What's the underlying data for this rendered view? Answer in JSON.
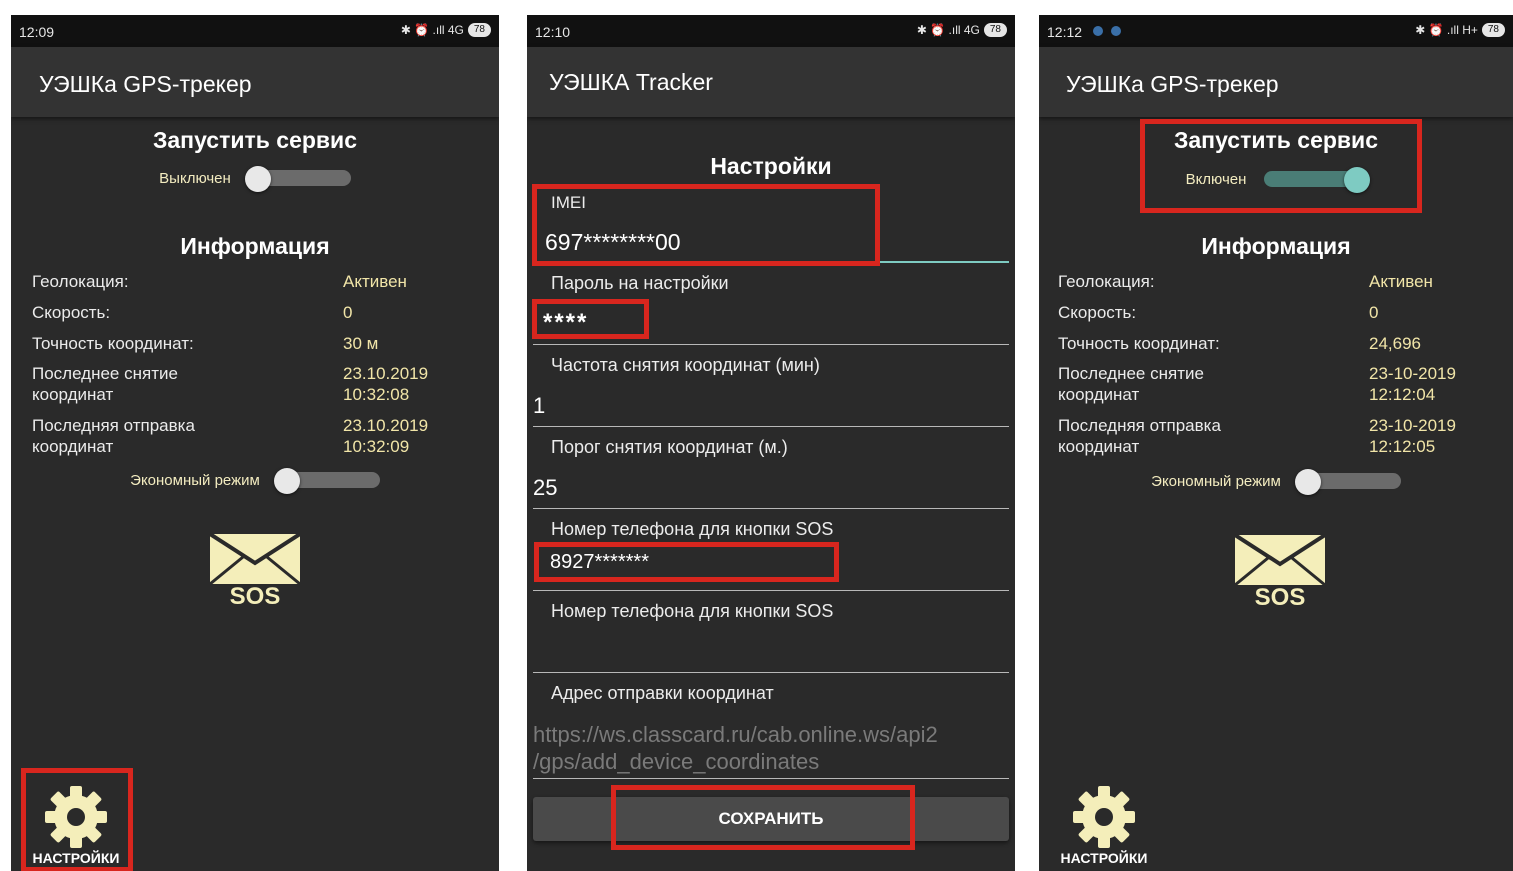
{
  "colors": {
    "accent_teal": "#7ecbc2",
    "value_yellow": "#f1e5a8",
    "highlight_red": "#d8261e",
    "background": "#2a2a2a"
  },
  "screen1": {
    "status_time": "12:09",
    "status_icons": "✱ ⏰ .ıll 4G",
    "battery": "78",
    "app_title": "УЭШКа GPS-трекер",
    "service_title": "Запустить сервис",
    "service_state_label": "Выключен",
    "service_on": false,
    "info_title": "Информация",
    "info": [
      {
        "label": "Геолокация:",
        "value": "Активен"
      },
      {
        "label": "Скорость:",
        "value": "0"
      },
      {
        "label": "Точность координат:",
        "value": "30 м"
      },
      {
        "label": "Последнее снятие координат",
        "value": "23.10.2019 10:32:08"
      },
      {
        "label": "Последняя отправка координат",
        "value": "23.10.2019 10:32:09"
      }
    ],
    "eco_label": "Экономный режим",
    "eco_on": false,
    "sos_label": "SOS",
    "settings_label": "НАСТРОЙКИ"
  },
  "screen2": {
    "status_time": "12:10",
    "status_icons": "✱ ⏰ .ıll 4G",
    "battery": "78",
    "app_title": "УЭШКА Tracker",
    "settings_title": "Настройки",
    "fields": [
      {
        "label": "IMEI",
        "value": "697********00"
      },
      {
        "label": "Пароль на настройки",
        "value": "****"
      },
      {
        "label": "Частота снятия координат (мин)",
        "value": "1"
      },
      {
        "label": "Порог снятия координат (м.)",
        "value": "25"
      },
      {
        "label": "Номер телефона для кнопки SOS",
        "value": "8927*******"
      },
      {
        "label": "Номер телефона для кнопки SOS",
        "value": ""
      },
      {
        "label": "Адрес отправки координат",
        "value": "https://ws.classcard.ru/cab.online.ws/api2 /gps/add_device_coordinates"
      }
    ],
    "save_label": "СОХРАНИТЬ"
  },
  "screen3": {
    "status_time": "12:12",
    "status_icons": "✱ ⏰ .ıll H+",
    "battery": "78",
    "app_title": "УЭШКа GPS-трекер",
    "service_title": "Запустить сервис",
    "service_state_label": "Включен",
    "service_on": true,
    "info_title": "Информация",
    "info": [
      {
        "label": "Геолокация:",
        "value": "Активен"
      },
      {
        "label": "Скорость:",
        "value": "0"
      },
      {
        "label": "Точность координат:",
        "value": "24,696"
      },
      {
        "label": "Последнее снятие координат",
        "value": "23-10-2019 12:12:04"
      },
      {
        "label": "Последняя отправка координат",
        "value": "23-10-2019 12:12:05"
      }
    ],
    "eco_label": "Экономный режим",
    "eco_on": false,
    "sos_label": "SOS",
    "settings_label": "НАСТРОЙКИ"
  }
}
